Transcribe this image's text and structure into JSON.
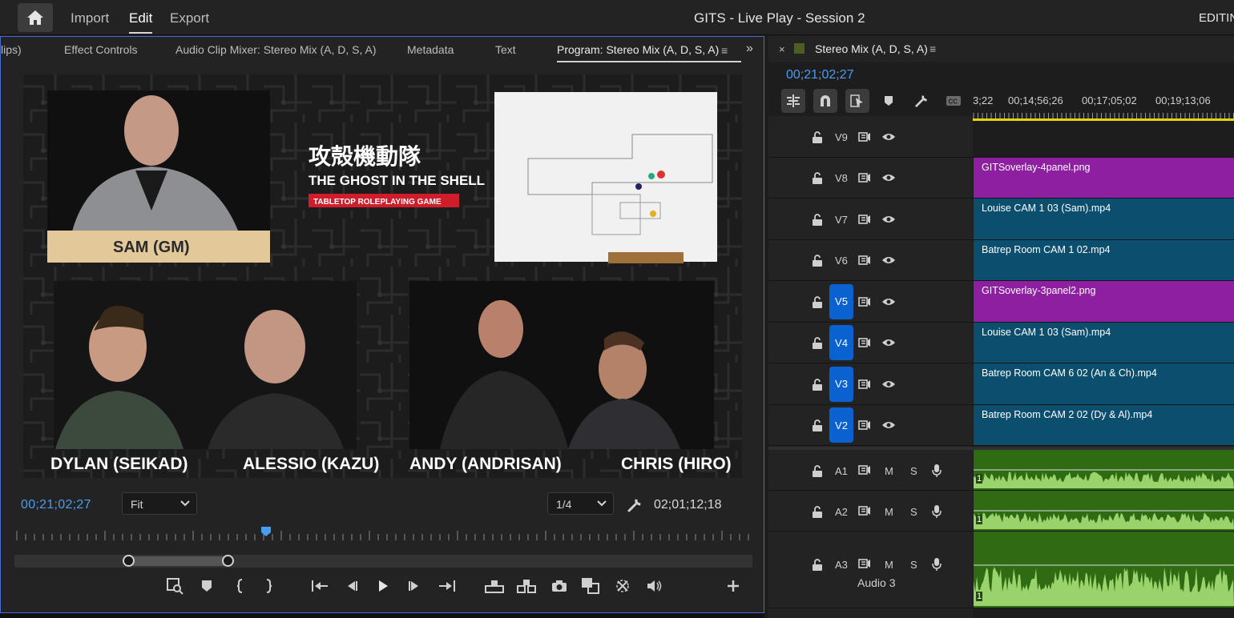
{
  "topbar": {
    "tabs": [
      "Import",
      "Edit",
      "Export"
    ],
    "active_tab": "Edit",
    "project_title": "GITS - Live Play - Session 2",
    "mode": "EDITING"
  },
  "left_panel": {
    "tabs": [
      "lips)",
      "Effect Controls",
      "Audio Clip Mixer: Stereo Mix (A, D, S, A)",
      "Metadata",
      "Text",
      "Program: Stereo Mix (A, D, S, A)"
    ],
    "active_tab": "Program: Stereo Mix (A, D, S, A)",
    "menu_icon": "≡",
    "overflow_icon": "»"
  },
  "video": {
    "logo_kanji": "攻殻機動隊",
    "logo_title": "THE GHOST IN THE SHELL",
    "logo_subtitle": "TABLETOP ROLEPLAYING GAME",
    "name_plate": "SAM (GM)",
    "players": [
      "DYLAN (SEIKAD)",
      "ALESSIO (KAZU)",
      "ANDY (ANDRISAN)",
      "CHRIS (HIRO)"
    ]
  },
  "monitor": {
    "current_timecode": "00;21;02;27",
    "fit_value": "Fit",
    "resolution_value": "1/4",
    "duration_timecode": "02;01;12;18",
    "playhead_fraction": 0.34,
    "zoom_start_fraction": 0.155,
    "zoom_end_fraction": 0.29
  },
  "sequence": {
    "name": "Stereo Mix (A, D, S, A)",
    "timecode": "00;21;02;27",
    "ruler_labels": [
      "3;22",
      "00;14;56;26",
      "00;17;05;02",
      "00;19;13;06"
    ],
    "swatch_color": "#4b5f1e"
  },
  "tracks": {
    "video": [
      {
        "name": "V9",
        "targeted": false,
        "clip": null
      },
      {
        "name": "V8",
        "targeted": false,
        "clip": "GITSoverlay-4panel.png",
        "kind": "overlay"
      },
      {
        "name": "V7",
        "targeted": false,
        "clip": "Louise  CAM 1 03 (Sam).mp4",
        "kind": "video"
      },
      {
        "name": "V6",
        "targeted": false,
        "clip": "Batrep Room CAM 1 02.mp4",
        "kind": "video"
      },
      {
        "name": "V5",
        "targeted": true,
        "clip": "GITSoverlay-3panel2.png",
        "kind": "overlay"
      },
      {
        "name": "V4",
        "targeted": true,
        "clip": "Louise  CAM 1 03 (Sam).mp4",
        "kind": "video"
      },
      {
        "name": "V3",
        "targeted": true,
        "clip": "Batrep Room CAM 6 02 (An & Ch).mp4",
        "kind": "video"
      },
      {
        "name": "V2",
        "targeted": true,
        "clip": "Batrep Room CAM 2 02 (Dy & Al).mp4",
        "kind": "video"
      }
    ],
    "audio": [
      {
        "name": "A1",
        "m": "M",
        "s": "S",
        "clip_num": "1"
      },
      {
        "name": "A2",
        "m": "M",
        "s": "S",
        "clip_num": "1"
      },
      {
        "name": "A3",
        "m": "M",
        "s": "S",
        "clip_num": "1",
        "label": "Audio 3"
      }
    ]
  },
  "colors": {
    "accent_blue": "#4a9cf0",
    "target_blue": "#0a62d1",
    "overlay_clip": "#8e1fa0",
    "video_clip": "#0c4e6e",
    "audio_clip": "#2e6b12",
    "waveform": "#9ad26b",
    "playhead_yellow": "#e5d40c"
  }
}
